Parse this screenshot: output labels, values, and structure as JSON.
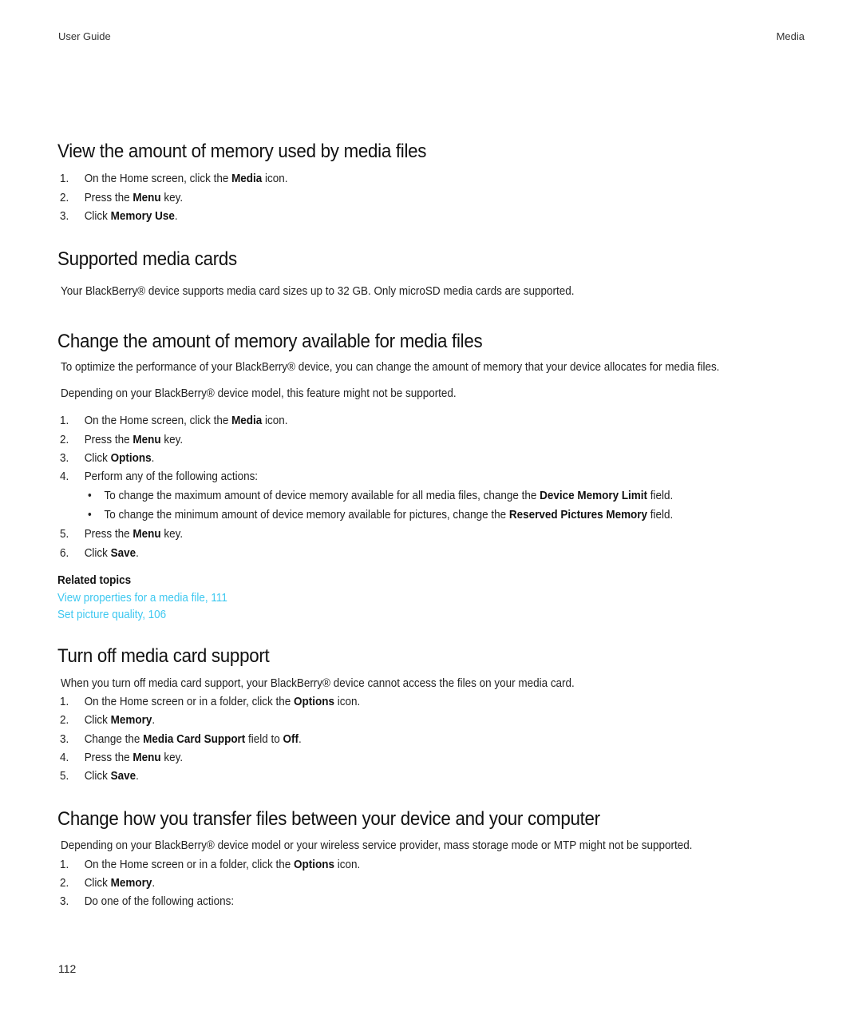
{
  "header": {
    "left": "User Guide",
    "right": "Media"
  },
  "sections": [
    {
      "title": "View the amount of memory used by media files",
      "steps": [
        {
          "num": "1.",
          "pre": "On the Home screen, click the ",
          "bold": "Media",
          "post": " icon."
        },
        {
          "num": "2.",
          "pre": "Press the ",
          "bold": "Menu",
          "post": " key."
        },
        {
          "num": "3.",
          "pre": "Click ",
          "bold": "Memory Use",
          "post": "."
        }
      ]
    },
    {
      "title": "Supported media cards",
      "paragraph": "Your BlackBerry® device supports media card sizes up to 32 GB. Only microSD media cards are supported."
    },
    {
      "title": "Change the amount of memory available for media files",
      "paragraphs": [
        "To optimize the performance of your BlackBerry® device, you can change the amount of memory that your device allocates for media files.",
        "Depending on your BlackBerry® device model, this feature might not be supported."
      ],
      "steps": [
        {
          "num": "1.",
          "pre": "On the Home screen, click the ",
          "bold": "Media",
          "post": " icon."
        },
        {
          "num": "2.",
          "pre": "Press the ",
          "bold": "Menu",
          "post": " key."
        },
        {
          "num": "3.",
          "pre": "Click ",
          "bold": "Options",
          "post": "."
        },
        {
          "num": "4.",
          "pre": "Perform any of the following actions:",
          "bold": "",
          "post": ""
        },
        {
          "num": "5.",
          "pre": "Press the ",
          "bold": "Menu",
          "post": " key."
        },
        {
          "num": "6.",
          "pre": "Click ",
          "bold": "Save",
          "post": "."
        }
      ],
      "bullets": [
        {
          "pre": "To change the maximum amount of device memory available for all media files, change the ",
          "bold": "Device Memory Limit",
          "post": " field."
        },
        {
          "pre": "To change the minimum amount of device memory available for pictures, change the ",
          "bold": "Reserved Pictures Memory",
          "post": " field."
        }
      ],
      "related_label": "Related topics",
      "related_links": [
        "View properties for a media file, 111",
        "Set picture quality, 106"
      ]
    },
    {
      "title": "Turn off media card support",
      "paragraph": "When you turn off media card support, your BlackBerry® device cannot access the files on your media card.",
      "steps": [
        {
          "num": "1.",
          "pre": "On the Home screen or in a folder, click the ",
          "bold": "Options",
          "post": " icon."
        },
        {
          "num": "2.",
          "pre": "Click ",
          "bold": "Memory",
          "post": "."
        },
        {
          "num": "3.",
          "pre": "Change the ",
          "bold": "Media Card Support",
          "post": " field to ",
          "bold2": "Off",
          "post2": "."
        },
        {
          "num": "4.",
          "pre": "Press the ",
          "bold": "Menu",
          "post": " key."
        },
        {
          "num": "5.",
          "pre": "Click ",
          "bold": "Save",
          "post": "."
        }
      ]
    },
    {
      "title": "Change how you transfer files between your device and your computer",
      "paragraph": "Depending on your BlackBerry® device model or your wireless service provider, mass storage mode or MTP might not be supported.",
      "steps": [
        {
          "num": "1.",
          "pre": "On the Home screen or in a folder, click the ",
          "bold": "Options",
          "post": " icon."
        },
        {
          "num": "2.",
          "pre": "Click ",
          "bold": "Memory",
          "post": "."
        },
        {
          "num": "3.",
          "pre": "Do one of the following actions:",
          "bold": "",
          "post": ""
        }
      ]
    }
  ],
  "page_number": "112"
}
